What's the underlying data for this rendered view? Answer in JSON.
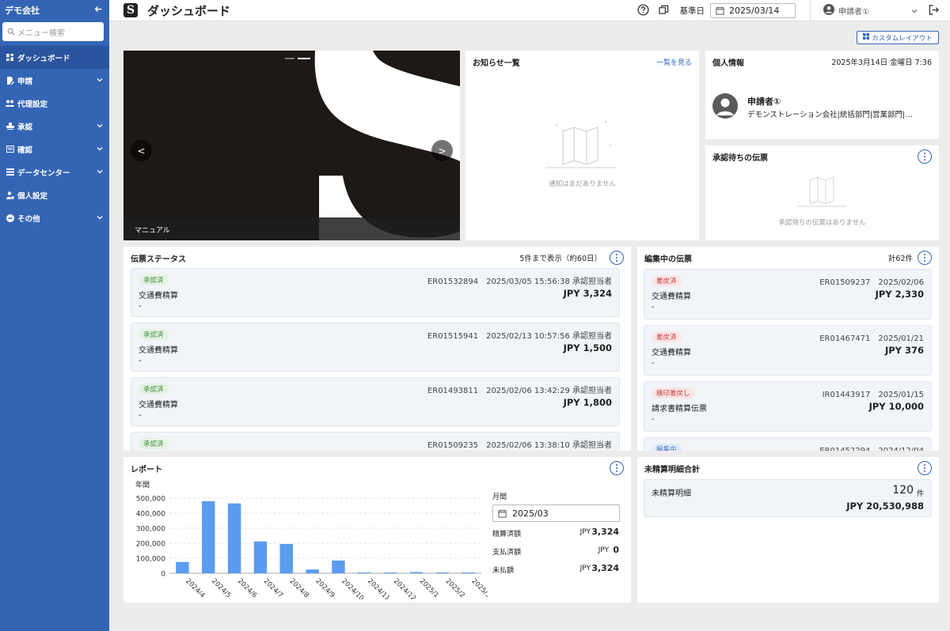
{
  "sidebar": {
    "company": "デモ会社",
    "search_placeholder": "メニュー検索",
    "items": [
      {
        "label": "ダッシュボード"
      },
      {
        "label": "申請"
      },
      {
        "label": "代理設定"
      },
      {
        "label": "承認"
      },
      {
        "label": "確認"
      },
      {
        "label": "データセンター"
      },
      {
        "label": "個人設定"
      },
      {
        "label": "その他"
      }
    ]
  },
  "header": {
    "logo_letter": "S",
    "title": "ダッシュボード",
    "base_date_label": "基準日",
    "base_date": "2025/03/14",
    "user": "申請者①"
  },
  "custom_layout_button": "カスタムレイアウト",
  "banner": {
    "caption": "マニュアル",
    "prev": "<",
    "next": ">",
    "logo_letter": "S"
  },
  "notices": {
    "title": "お知らせ一覧",
    "view_all": "一覧を見る",
    "empty": "通知はまだありません"
  },
  "profile": {
    "title": "個人情報",
    "datetime": "2025年3月14日 金曜日 7:36",
    "name": "申請者①",
    "org": "デモンストレーション会社|統括部門|営業部門|…"
  },
  "approvals": {
    "title": "承認待ちの伝票",
    "empty": "承認待ちの伝票はありません"
  },
  "slip_status": {
    "title": "伝票ステータス",
    "subtitle": "5件まで表示（約60日）",
    "items": [
      {
        "badge": "承認済",
        "meta": "ER01532894　2025/03/05 15:56:38 承認担当者",
        "name": "交通費精算",
        "amount": "JPY 3,324",
        "note": "-"
      },
      {
        "badge": "承認済",
        "meta": "ER01515941　2025/02/13 10:57:56 承認担当者",
        "name": "交通費精算",
        "amount": "JPY 1,500",
        "note": "-"
      },
      {
        "badge": "承認済",
        "meta": "ER01493811　2025/02/06 13:42:29 承認担当者",
        "name": "交通費精算",
        "amount": "JPY 1,800",
        "note": "-"
      },
      {
        "badge": "承認済",
        "meta": "ER01509235　2025/02/06 13:38:10 承認担当者",
        "name": "",
        "amount": "",
        "note": ""
      }
    ]
  },
  "editing": {
    "title": "編集中の伝票",
    "count": "計62件",
    "items": [
      {
        "badge": "差戻済",
        "meta": "ER01509237　2025/02/06",
        "name": "交通費精算",
        "amount": "JPY 2,330",
        "note": "-"
      },
      {
        "badge": "差戻済",
        "meta": "ER01467471　2025/01/21",
        "name": "交通費精算",
        "amount": "JPY 376",
        "note": "-"
      },
      {
        "badge": "検印差戻し",
        "meta": "IR01443917　2025/01/15",
        "name": "請求書精算伝票",
        "amount": "JPY 10,000",
        "note": "-"
      },
      {
        "badge": "編集中",
        "meta": "ER01452294　2024/12/04",
        "name": "",
        "amount": "",
        "note": ""
      }
    ]
  },
  "report": {
    "title": "レポート",
    "chart_label": "年間",
    "month_label": "月間",
    "month": "2025/03",
    "rows": [
      {
        "label": "精算済額",
        "currency": "JPY",
        "value": "3,324"
      },
      {
        "label": "支払済額",
        "currency": "JPY",
        "value": "0"
      },
      {
        "label": "未払額",
        "currency": "JPY",
        "value": "3,324"
      }
    ]
  },
  "unsettled": {
    "title": "未精算明細合計",
    "label": "未精算明細",
    "count": "120",
    "count_unit": "件",
    "amount": "JPY 20,530,988"
  },
  "chart_data": {
    "type": "bar",
    "title": "年間",
    "categories": [
      "2024/4",
      "2024/5",
      "2024/6",
      "2024/7",
      "2024/8",
      "2024/9",
      "2024/10",
      "2024/11",
      "2024/12",
      "2025/1",
      "2025/2",
      "2025/3"
    ],
    "values": [
      75000,
      480000,
      465000,
      212000,
      195000,
      25000,
      85000,
      3000,
      3000,
      8000,
      3000,
      3324
    ],
    "ylim": [
      0,
      500000
    ],
    "yticks": [
      "500,000",
      "400,000",
      "300,000",
      "200,000",
      "100,000",
      "0"
    ],
    "grid": true,
    "color": "#5b9cf0"
  },
  "colors": {
    "sidebar": "#3465b5",
    "accent": "#3465b5",
    "bar": "#5b9cf0"
  }
}
